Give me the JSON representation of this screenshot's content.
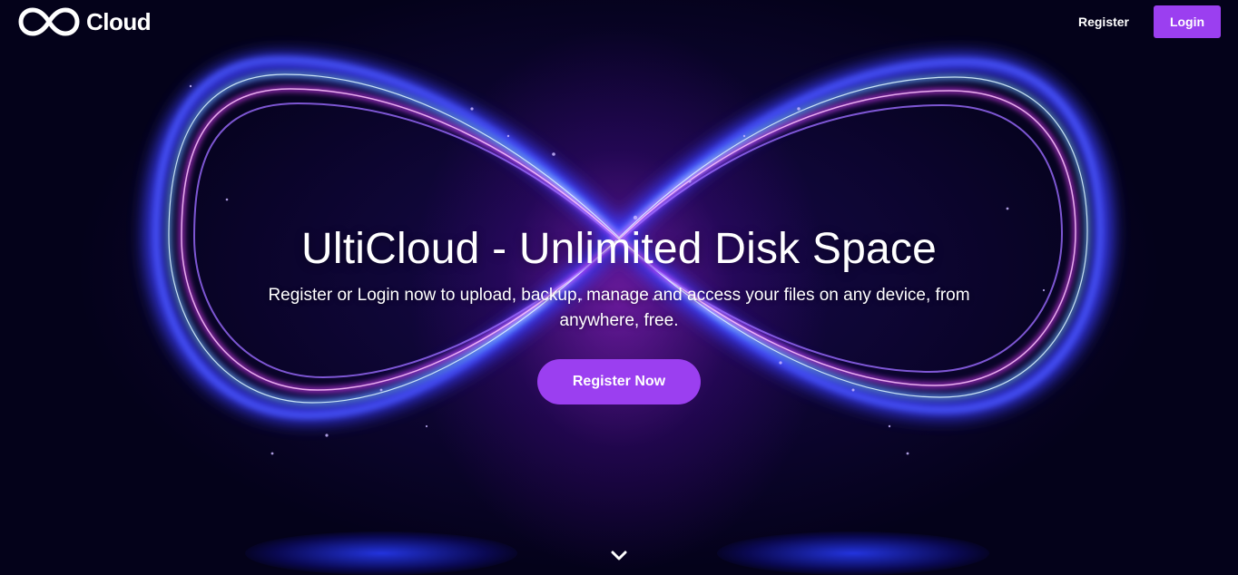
{
  "header": {
    "logo_text": "Cloud",
    "logo_icon": "infinity-icon",
    "register_label": "Register",
    "login_label": "Login"
  },
  "hero": {
    "title": "UltiCloud - Unlimited Disk Space",
    "subtitle": "Register or Login now to upload, backup, manage and access your files on any device, from anywhere, free.",
    "cta_label": "Register Now",
    "scroll_icon": "chevron-down-icon",
    "background_image": "glowing-infinity-symbol"
  },
  "colors": {
    "background": "#04021a",
    "accent": "#9b3ff0",
    "glow_magenta": "#e040ff",
    "glow_blue": "#3a4dff",
    "glow_cyan": "#7fd8ff"
  }
}
